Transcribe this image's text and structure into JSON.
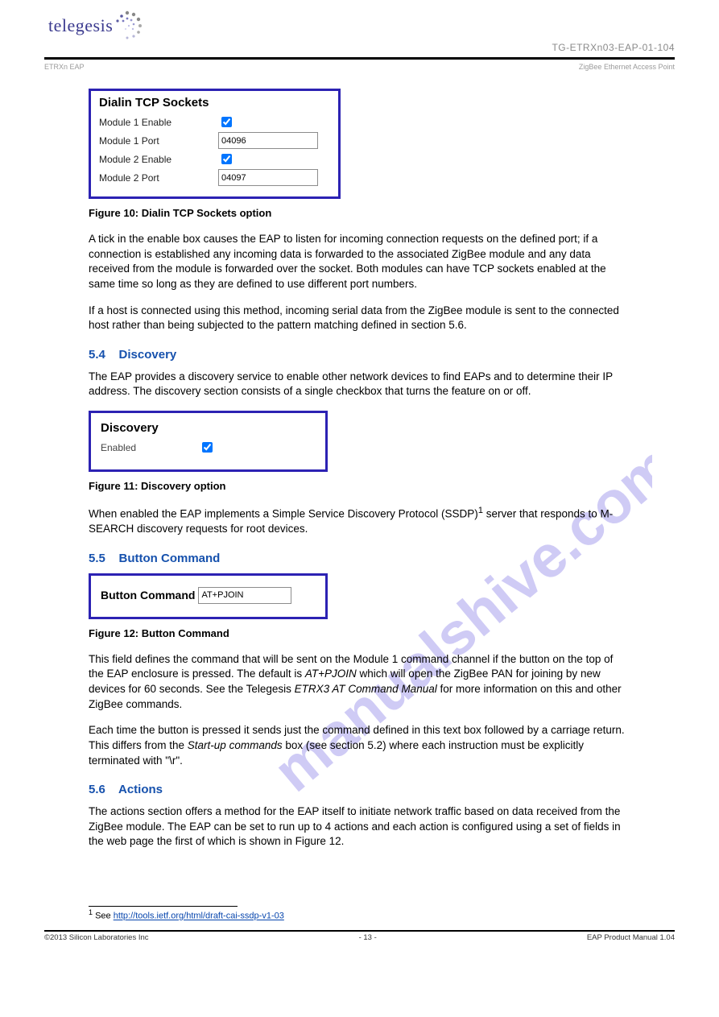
{
  "header": {
    "logo_text": "telegesis",
    "tagline": "TG-ETRXn03-EAP-01-104",
    "ribbon_left": "ETRXn EAP",
    "ribbon_right": "ZigBee Ethernet Access Point"
  },
  "panel_dialin": {
    "title": "Dialin TCP Sockets",
    "module1_enable_label": "Module 1 Enable",
    "module1_enable_checked": true,
    "module1_port_label": "Module 1 Port",
    "module1_port_value": "04096",
    "module2_enable_label": "Module 2 Enable",
    "module2_enable_checked": true,
    "module2_port_label": "Module 2 Port",
    "module2_port_value": "04097"
  },
  "fig10_cap": "Figure 10: Dialin TCP Sockets option",
  "p1": "A tick in the enable box causes the EAP to listen for incoming connection requests on the defined port; if a connection is established any incoming data is forwarded to the associated ZigBee module and any data received from the module is forwarded over the socket. Both modules can have TCP sockets enabled at the same time so long as they are defined to use different port numbers.",
  "p2": "If a host is connected using this method, incoming serial data from the ZigBee module is sent to the connected host rather than being subjected to the pattern matching defined in section 5.6.",
  "h_discovery_num": "5.4",
  "h_discovery": "Discovery",
  "p3": "The EAP provides a discovery service to enable other network devices to find EAPs and to determine their IP address. The discovery section consists of a single checkbox that turns the feature on or off.",
  "panel_discovery": {
    "title": "Discovery",
    "enabled_label": "Enabled",
    "enabled_checked": true
  },
  "fig11_cap": "Figure 11: Discovery option",
  "p4a": "When enabled the EAP implements a Simple Service Discovery Protocol (SSDP)",
  "p4sup": "1",
  "p4b": " server that responds to M-SEARCH discovery requests for root devices.",
  "h_button_num": "5.5",
  "h_button": "Button Command",
  "panel_btncmd": {
    "label": "Button Command",
    "value": "AT+PJOIN"
  },
  "fig12_cap": "Figure 12: Button Command",
  "p5a": "This field defines the command that will be sent on the Module 1 command channel if the button on the top of the EAP enclosure is pressed. The default is ",
  "p5i": "AT+PJOIN",
  "p5b": " which will open the ZigBee PAN for joining by new devices for 60 seconds. See the Telegesis ",
  "p5i2": "ETRX3 AT Command Manual",
  "p5c": " for more information on this and other ZigBee commands.",
  "p6a": "Each time the button is pressed it sends just the command defined in this text box followed by a carriage return. This differs from the ",
  "p6i": "Start-up commands",
  "p6b": " box (see section 5.2) where each instruction must be explicitly terminated with \"\\r\".",
  "h_actions_num": "5.6",
  "h_actions": "Actions",
  "p7": "The actions section offers a method for the EAP itself to initiate network traffic based on data received from the ZigBee module. The EAP can be set to run up to 4 actions and each action is configured using a set of fields in the web page the first of which is shown in Figure 12.",
  "footnote_sup": "1",
  "footnote_text": " See ",
  "footnote_link": "http://tools.ietf.org/html/draft-cai-ssdp-v1-03",
  "footer": {
    "left": "©2013 Silicon Laboratories Inc",
    "center": "- 13 -",
    "right": "EAP Product Manual 1.04"
  },
  "watermark": "manualshive.com"
}
